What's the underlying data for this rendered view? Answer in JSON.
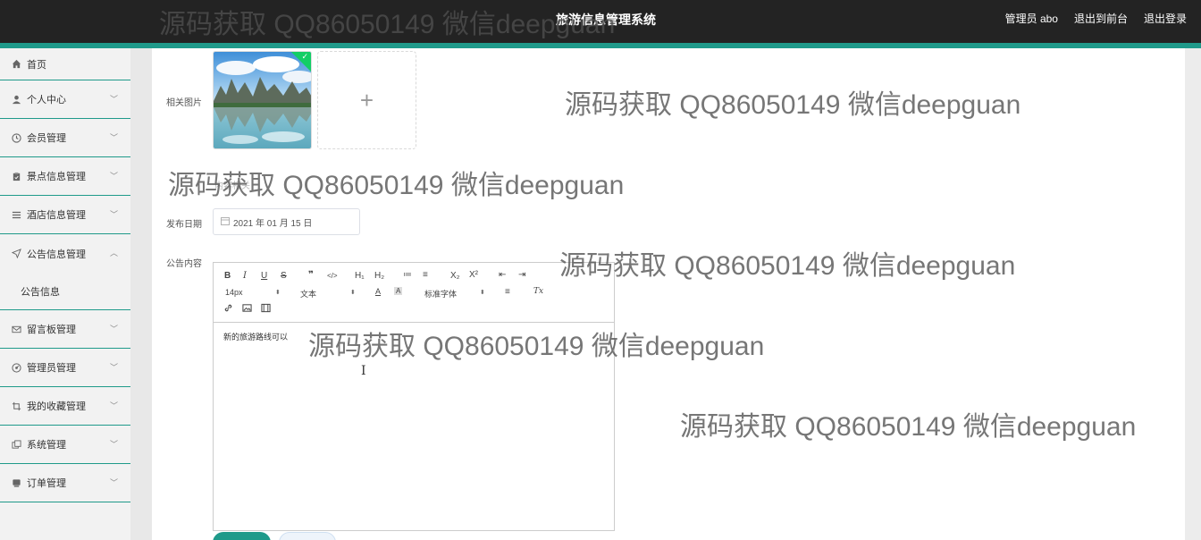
{
  "header": {
    "title": "旅游信息管理系统",
    "user_label": "管理员 abo",
    "to_front_label": "退出到前台",
    "logout_label": "退出登录"
  },
  "sidebar": {
    "items": [
      {
        "label": "首页",
        "icon": "home-icon"
      },
      {
        "label": "个人中心",
        "icon": "user-icon"
      },
      {
        "label": "会员管理",
        "icon": "clock-icon"
      },
      {
        "label": "景点信息管理",
        "icon": "clipboard-icon"
      },
      {
        "label": "酒店信息管理",
        "icon": "list-icon"
      },
      {
        "label": "公告信息管理",
        "icon": "send-icon"
      },
      {
        "label": "公告信息",
        "icon": ""
      },
      {
        "label": "留言板管理",
        "icon": "mail-icon"
      },
      {
        "label": "管理员管理",
        "icon": "dashboard-icon"
      },
      {
        "label": "我的收藏管理",
        "icon": "crop-icon"
      },
      {
        "label": "系统管理",
        "icon": "copy-icon"
      },
      {
        "label": "订单管理",
        "icon": "chat-icon"
      }
    ]
  },
  "form": {
    "image_label": "相关图片",
    "upload_plus": "+",
    "date_label": "发布日期",
    "date_value": "2021 年 01 月 15 日",
    "content_label": "公告内容",
    "editor_text": "新的旅游路线可以",
    "obscured_label": "内容相关"
  },
  "editor_toolbar": {
    "bold": "B",
    "italic": "I",
    "underline": "U",
    "strike": "S",
    "quote": "❞",
    "code": "</>",
    "h1": "H₁",
    "h2": "H₂",
    "ordered_list": "≔",
    "bullet_list": "≡",
    "subscript": "X₂",
    "superscript": "X²",
    "outdent": "⇤",
    "indent": "⇥",
    "font_size": "14px",
    "text_type": "文本",
    "font_color": "A",
    "bg_color": "A",
    "font_family": "标准字体",
    "align": "≡",
    "clear_format": "Tx",
    "link": "🔗",
    "image": "▣",
    "video": "▤"
  },
  "watermarks": [
    "源码获取 QQ86050149 微信deepguan",
    "源码获取 QQ86050149 微信deepguan",
    "源码获取 QQ86050149 微信deepguan",
    "源码获取 QQ86050149 微信deepguan",
    "源码获取 QQ86050149 微信deepguan",
    "源码获取 QQ86050149 微信deepguan"
  ],
  "colors": {
    "accent": "#1f9a8a",
    "topbar": "#232323",
    "check": "#13ce66"
  }
}
